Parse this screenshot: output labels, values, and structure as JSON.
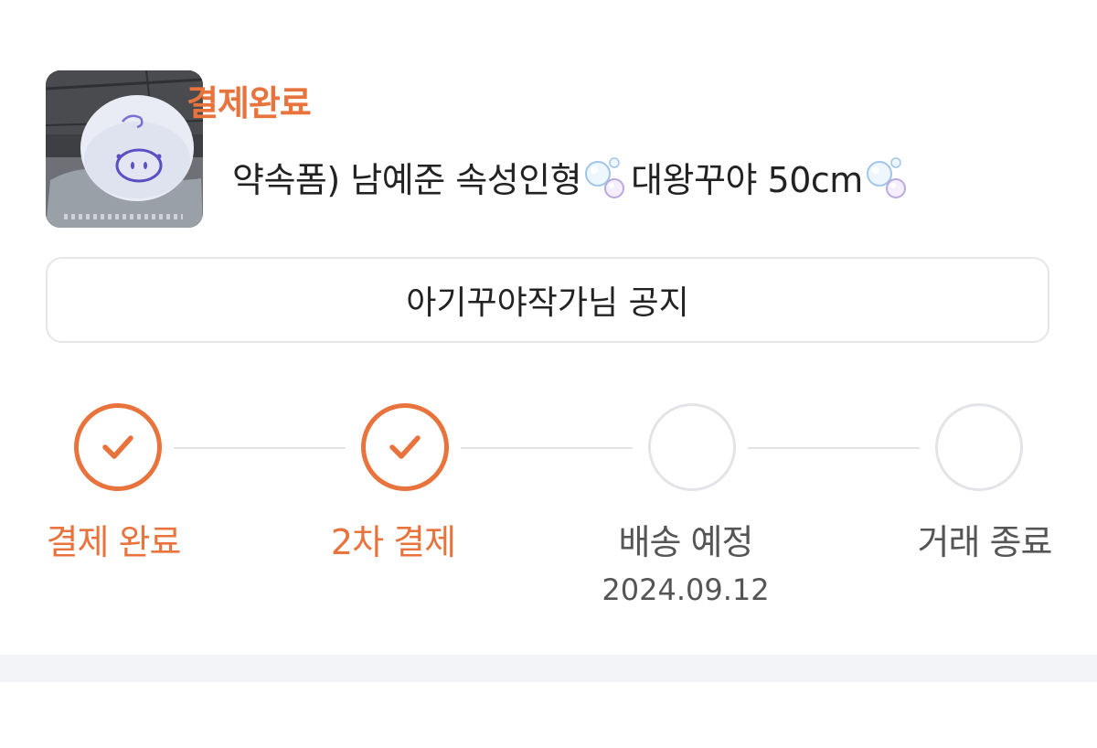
{
  "order": {
    "status_title": "결제완료",
    "product_name": "약속폼) 남예준 속성인형",
    "product_name_suffix": "대왕꾸야 50cm",
    "thumbnail_icon": "plush-photo"
  },
  "notice_button": {
    "label": "아기꾸야작가님 공지"
  },
  "progress": {
    "steps": [
      {
        "label": "결제 완료",
        "state": "done"
      },
      {
        "label": "2차 결제",
        "state": "done"
      },
      {
        "label": "배송 예정",
        "state": "todo",
        "date": "2024.09.12"
      },
      {
        "label": "거래 종료",
        "state": "todo"
      }
    ]
  },
  "colors": {
    "accent": "#e8733d",
    "inactive": "#e2e4e8",
    "band": "#f3f4f7"
  }
}
